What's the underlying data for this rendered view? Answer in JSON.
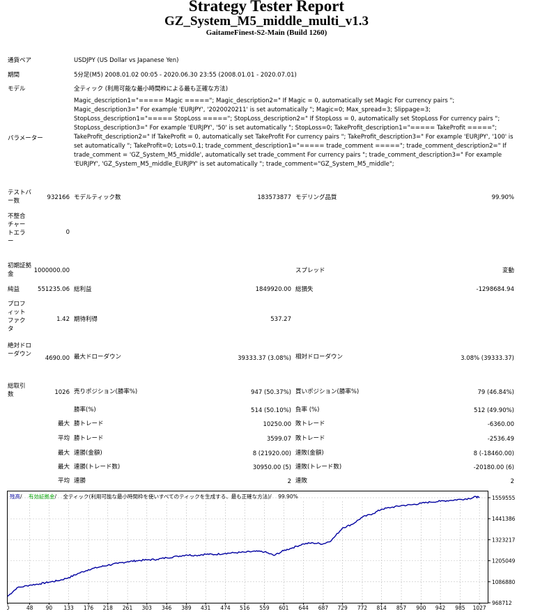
{
  "header": {
    "title": "Strategy Tester Report",
    "ea_name": "GZ_System_M5_middle_multi_v1.3",
    "server": "GaitameFinest-S2-Main (Build 1260)"
  },
  "info": {
    "symbol_label": "通貨ペア",
    "symbol_value": "USDJPY (US Dollar vs Japanese Yen)",
    "period_label": "期間",
    "period_value": "5分足(M5) 2008.01.02 00:05 - 2020.06.30 23:55 (2008.01.01 - 2020.07.01)",
    "model_label": "モデル",
    "model_value": "全ティック (利用可能な最小時間枠による最も正確な方法)",
    "params_label": "パラメーター",
    "params_value": "Magic_description1=\"===== Magic =====\"; Magic_description2=\" If Magic = 0, automatically set Magic For currency pairs \"; Magic_description3=\" For example 'EURJPY', '2020020211' is set automatically \"; Magic=0; Max_spread=3; Slippage=3; StopLoss_description1=\"===== StopLoss =====\"; StopLoss_description2=\" If StopLoss = 0, automatically set StopLoss For currency pairs \"; StopLoss_description3=\" For example 'EURJPY', '50' is set automatically \"; StopLoss=0; TakeProfit_description1=\"===== TakeProfit =====\"; TakeProfit_description2=\" If TakeProfit = 0, automatically set TakeProfit For currency pairs \"; TakeProfit_description3=\" For example 'EURJPY', '100' is set automatically \"; TakeProfit=0; Lots=0.1; trade_comment_description1=\"===== trade_comment =====\"; trade_comment_description2=\" If trade_comment = 'GZ_System_M5_middle', automatically set trade_comment For currency pairs \"; trade_comment_description3=\" For example 'EURJPY', 'GZ_System_M5_middle_EURJPY' is set automatically \"; trade_comment=\"GZ_System_M5_middle\";"
  },
  "stats": {
    "bars_label": "テストバー数",
    "bars_value": "932166",
    "ticks_label": "モデルティック数",
    "ticks_value": "183573877",
    "quality_label": "モデリング品質",
    "quality_value": "99.90%",
    "mismatch_label": "不整合チャートエラー",
    "mismatch_value": "0",
    "deposit_label": "初期証拠金",
    "deposit_value": "1000000.00",
    "spread_label": "スプレッド",
    "spread_value": "変動",
    "net_label": "純益",
    "net_value": "551235.06",
    "gross_profit_label": "総利益",
    "gross_profit_value": "1849920.00",
    "gross_loss_label": "総損失",
    "gross_loss_value": "-1298684.94",
    "pf_label": "プロフィットファクタ",
    "pf_value": "1.42",
    "expected_label": "期待利得",
    "expected_value": "537.27",
    "abs_dd_label": "絶対ドローダウン",
    "abs_dd_value": "4690.00",
    "max_dd_label": "最大ドローダウン",
    "max_dd_value": "39333.37 (3.08%)",
    "rel_dd_label": "相対ドローダウン",
    "rel_dd_value": "3.08% (39333.37)",
    "total_label": "総取引数",
    "total_value": "1026",
    "short_label": "売りポジション(勝率%)",
    "short_value": "947 (50.37%)",
    "long_label": "買いポジション(勝率%)",
    "long_value": "79 (46.84%)",
    "win_label": "勝率(%)",
    "win_value": "514 (50.10%)",
    "loss_label": "負率 (%)",
    "loss_value": "512 (49.90%)",
    "max_word": "最大",
    "avg_word": "平均",
    "max_win_label": "勝トレード",
    "max_win_value": "10250.00",
    "max_loss_label": "敗トレード",
    "max_loss_value": "-6360.00",
    "avg_win_label": "勝トレード",
    "avg_win_value": "3599.07",
    "avg_loss_label": "敗トレード",
    "avg_loss_value": "-2536.49",
    "cons_win_money_label": "連勝(金額)",
    "cons_win_money_value": "8 (21920.00)",
    "cons_loss_money_label": "連敗(金額)",
    "cons_loss_money_value": "8 (-18460.00)",
    "cons_win_count_label": "連勝(トレード数)",
    "cons_win_count_value": "30950.00 (5)",
    "cons_loss_count_label": "連敗(トレード数)",
    "cons_loss_count_value": "-20180.00 (6)",
    "avg_cons_win_label": "連勝",
    "avg_cons_win_value": "2",
    "avg_cons_loss_label": "連敗",
    "avg_cons_loss_value": "2"
  },
  "chart_data": {
    "type": "line",
    "legend": [
      "残高",
      "有効証拠金",
      "全ティック(利用可能な最小時間枠を使いすべてのティックを生成する、最も正確な方法)",
      "99.90%"
    ],
    "legend_colors": [
      "#0000a0",
      "#00a000",
      "#000000",
      "#000000"
    ],
    "x_ticks": [
      0,
      48,
      90,
      133,
      176,
      218,
      261,
      303,
      346,
      389,
      431,
      474,
      516,
      559,
      601,
      644,
      687,
      729,
      772,
      814,
      857,
      900,
      942,
      985,
      1027
    ],
    "y_ticks": [
      968712,
      1086880,
      1205049,
      1323217,
      1441386,
      1559555
    ],
    "xlim": [
      0,
      1045
    ],
    "ylim": [
      968712,
      1595000
    ],
    "series": [
      {
        "color": "#0000a0",
        "x": [
          0,
          20,
          48,
          70,
          90,
          110,
          133,
          155,
          176,
          200,
          218,
          240,
          261,
          280,
          303,
          325,
          346,
          370,
          389,
          410,
          431,
          450,
          474,
          495,
          516,
          540,
          559,
          580,
          601,
          620,
          644,
          665,
          687,
          705,
          729,
          750,
          772,
          795,
          814,
          835,
          857,
          880,
          900,
          920,
          942,
          965,
          985,
          1005,
          1020,
          1027
        ],
        "y": [
          1005000,
          1052000,
          1068000,
          1075000,
          1085000,
          1093000,
          1110000,
          1135000,
          1155000,
          1170000,
          1180000,
          1190000,
          1200000,
          1205000,
          1210000,
          1213000,
          1222000,
          1230000,
          1238000,
          1235000,
          1242000,
          1240000,
          1247000,
          1250000,
          1253000,
          1258000,
          1255000,
          1235000,
          1262000,
          1278000,
          1300000,
          1305000,
          1300000,
          1320000,
          1390000,
          1410000,
          1450000,
          1470000,
          1495000,
          1505000,
          1515000,
          1520000,
          1528000,
          1535000,
          1540000,
          1545000,
          1550000,
          1555000,
          1565000,
          1559555
        ]
      }
    ]
  }
}
